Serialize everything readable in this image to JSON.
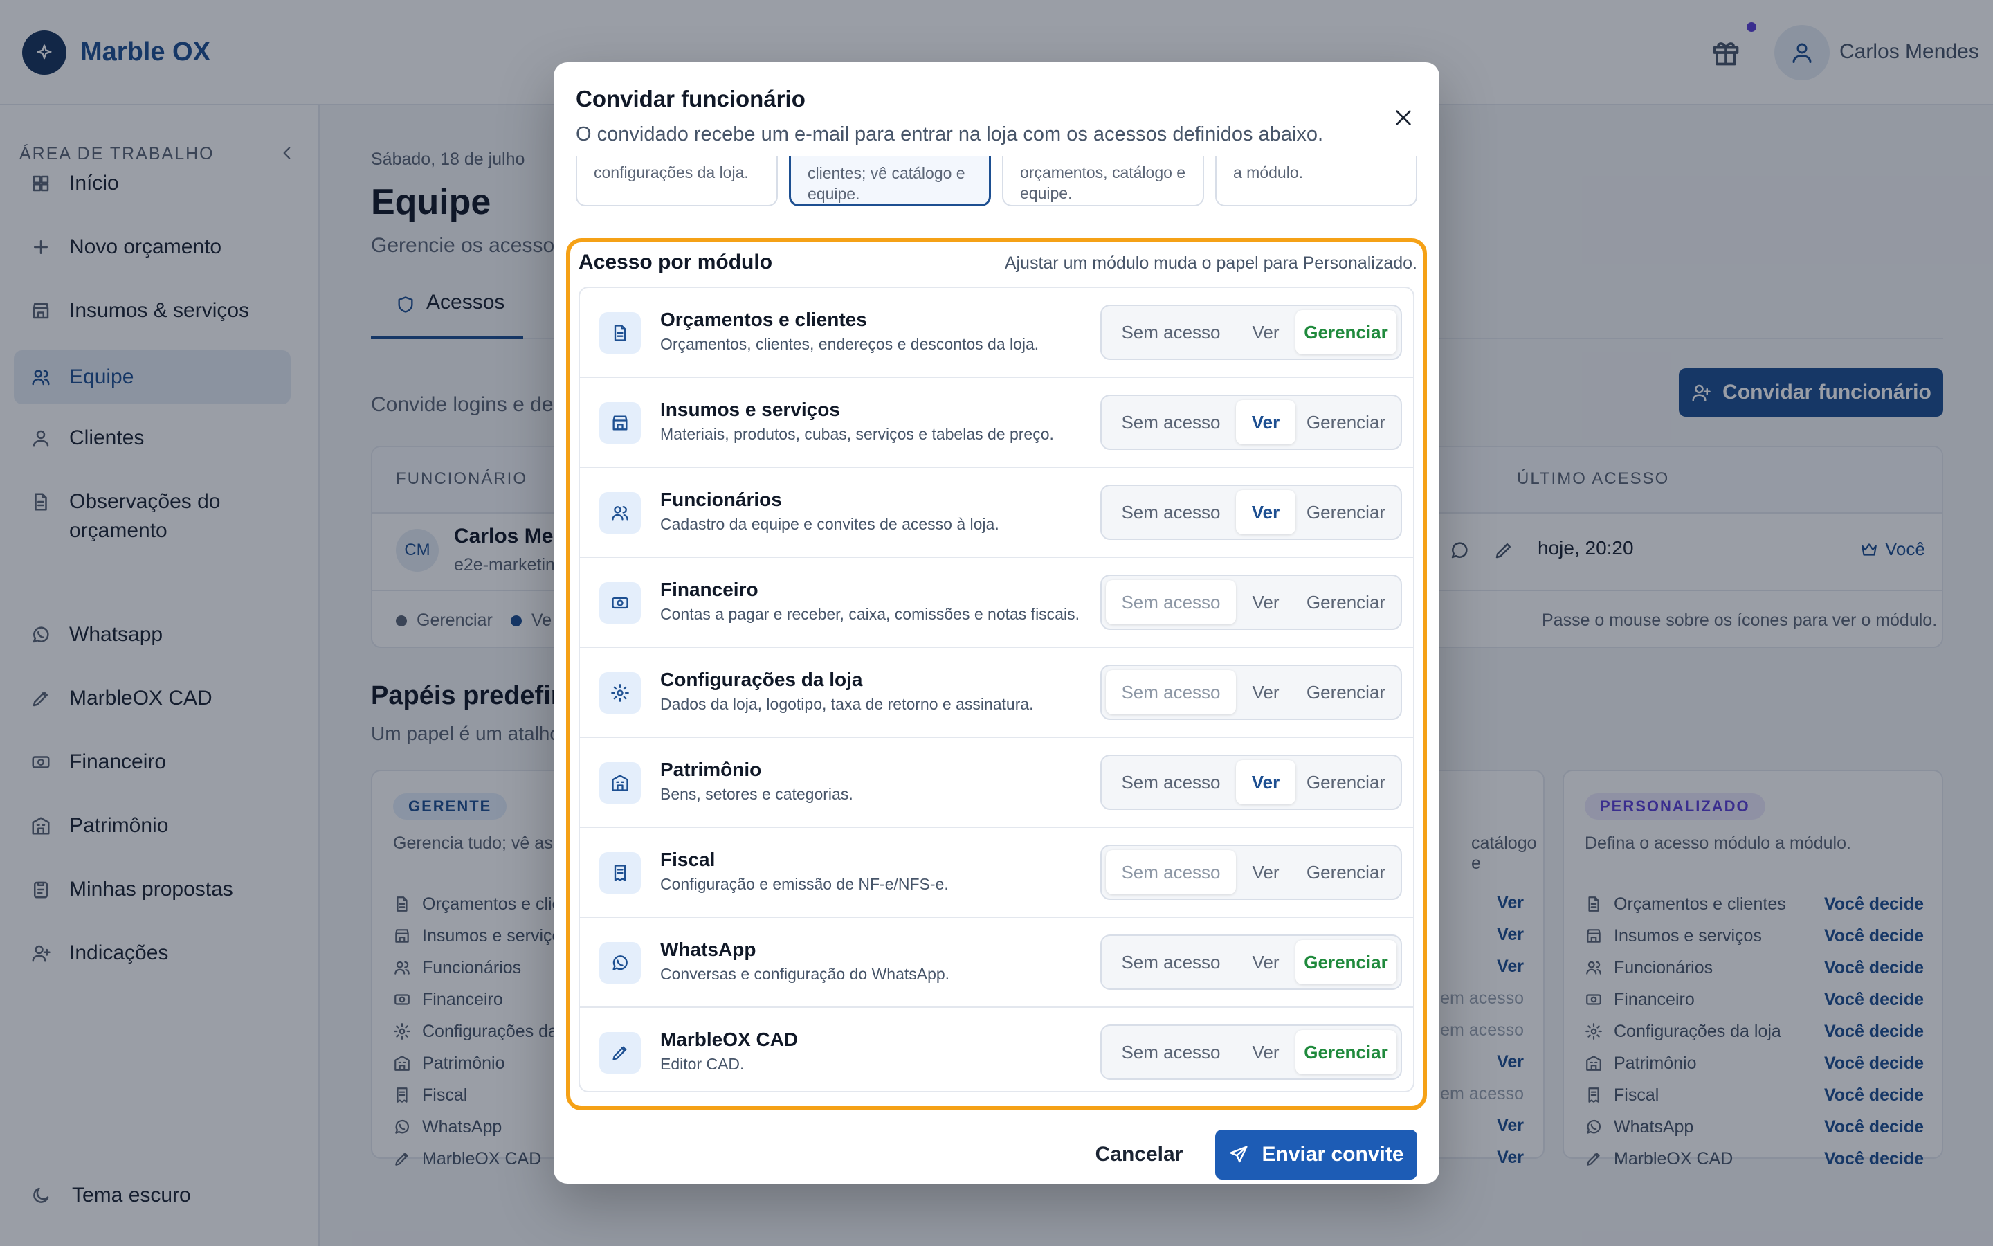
{
  "app": {
    "brand": "Marble OX",
    "user_name": "Carlos Mendes"
  },
  "colors": {
    "brand": "#1d4f91",
    "manage": "#1f8a3c",
    "highlight": "#f5a116",
    "badge_manager": "#1d4f91",
    "badge_custom": "#5b3fd6"
  },
  "sidebar": {
    "section_title": "ÁREA DE TRABALHO",
    "items": [
      {
        "label": "Início",
        "icon": "grid-icon"
      },
      {
        "label": "Novo orçamento",
        "icon": "plus-icon"
      },
      {
        "label": "Insumos & serviços",
        "icon": "store-icon"
      },
      {
        "label": "Equipe",
        "icon": "users-icon"
      },
      {
        "label": "Clientes",
        "icon": "user-icon"
      },
      {
        "label": "Observações do\norçamento",
        "icon": "document-icon"
      },
      {
        "label": "Whatsapp",
        "icon": "whatsapp-icon"
      },
      {
        "label": "MarbleOX CAD",
        "icon": "pencil-icon"
      },
      {
        "label": "Financeiro",
        "icon": "cash-icon"
      },
      {
        "label": "Patrimônio",
        "icon": "building-icon"
      },
      {
        "label": "Minhas propostas",
        "icon": "clipboard-icon"
      },
      {
        "label": "Indicações",
        "icon": "user-plus-icon"
      }
    ],
    "theme_toggle": "Tema escuro"
  },
  "page": {
    "date": "Sábado, 18 de julho",
    "title": "Equipe",
    "subtitle": "Gerencie os acessos",
    "tab_access": "Acessos",
    "invite_desc": "Convide logins e deci",
    "invite_button": "Convidar funcionário"
  },
  "employees": {
    "col_employee": "FUNCIONÁRIO",
    "col_last_access": "ÚLTIMO ACESSO",
    "row": {
      "initials": "CM",
      "name": "Carlos Men",
      "email": "e2e-marketin",
      "last_access": "hoje, 20:20",
      "you": "Você"
    },
    "legend_manage": "Gerenciar",
    "legend_view": "Ve",
    "hint": "Passe o mouse sobre os ícones para ver o módulo."
  },
  "roles": {
    "title": "Papéis predefini",
    "subtitle": "Um papel é um atalho",
    "manager": {
      "badge": "GERENTE",
      "desc": "Gerencia tudo; vê as c",
      "modules": [
        "Orçamentos e clie",
        "Insumos e serviço",
        "Funcionários",
        "Financeiro",
        "Configurações da",
        "Patrimônio",
        "Fiscal",
        "WhatsApp",
        "MarbleOX CAD"
      ]
    },
    "third": {
      "desc": "catálogo e",
      "values": [
        "Ver",
        "Ver",
        "Ver",
        "Sem acesso",
        "Sem acesso",
        "Ver",
        "Sem acesso",
        "Ver",
        "Ver"
      ]
    },
    "custom": {
      "badge": "PERSONALIZADO",
      "desc": "Defina o acesso módulo a módulo.",
      "modules": [
        "Orçamentos e clientes",
        "Insumos e serviços",
        "Funcionários",
        "Financeiro",
        "Configurações da loja",
        "Patrimônio",
        "Fiscal",
        "WhatsApp",
        "MarbleOX CAD"
      ],
      "value": "Você decide"
    }
  },
  "modal": {
    "title": "Convidar funcionário",
    "description": "O convidado recebe um e-mail para entrar na loja com os acessos definidos abaixo.",
    "presets": [
      "configurações da loja.",
      "clientes; vê catálogo e equipe.",
      "orçamentos, catálogo e equipe.",
      "a módulo."
    ],
    "module_section_title": "Acesso por módulo",
    "module_section_hint": "Ajustar um módulo muda o papel para Personalizado.",
    "options": {
      "none": "Sem acesso",
      "view": "Ver",
      "manage": "Gerenciar"
    },
    "modules": [
      {
        "name": "Orçamentos e clientes",
        "desc": "Orçamentos, clientes, endereços e descontos da loja.",
        "icon": "document-icon",
        "level": "manage"
      },
      {
        "name": "Insumos e serviços",
        "desc": "Materiais, produtos, cubas, serviços e tabelas de preço.",
        "icon": "store-icon",
        "level": "view"
      },
      {
        "name": "Funcionários",
        "desc": "Cadastro da equipe e convites de acesso à loja.",
        "icon": "users-icon",
        "level": "view"
      },
      {
        "name": "Financeiro",
        "desc": "Contas a pagar e receber, caixa, comissões e notas fiscais.",
        "icon": "cash-icon",
        "level": "none"
      },
      {
        "name": "Configurações da loja",
        "desc": "Dados da loja, logotipo, taxa de retorno e assinatura.",
        "icon": "gear-icon",
        "level": "none"
      },
      {
        "name": "Patrimônio",
        "desc": "Bens, setores e categorias.",
        "icon": "building-icon",
        "level": "view"
      },
      {
        "name": "Fiscal",
        "desc": "Configuração e emissão de NF-e/NFS-e.",
        "icon": "receipt-icon",
        "level": "none"
      },
      {
        "name": "WhatsApp",
        "desc": "Conversas e configuração do WhatsApp.",
        "icon": "whatsapp-icon",
        "level": "manage"
      },
      {
        "name": "MarbleOX CAD",
        "desc": "Editor CAD.",
        "icon": "pencil-icon",
        "level": "manage"
      }
    ],
    "cancel": "Cancelar",
    "submit": "Enviar convite"
  }
}
